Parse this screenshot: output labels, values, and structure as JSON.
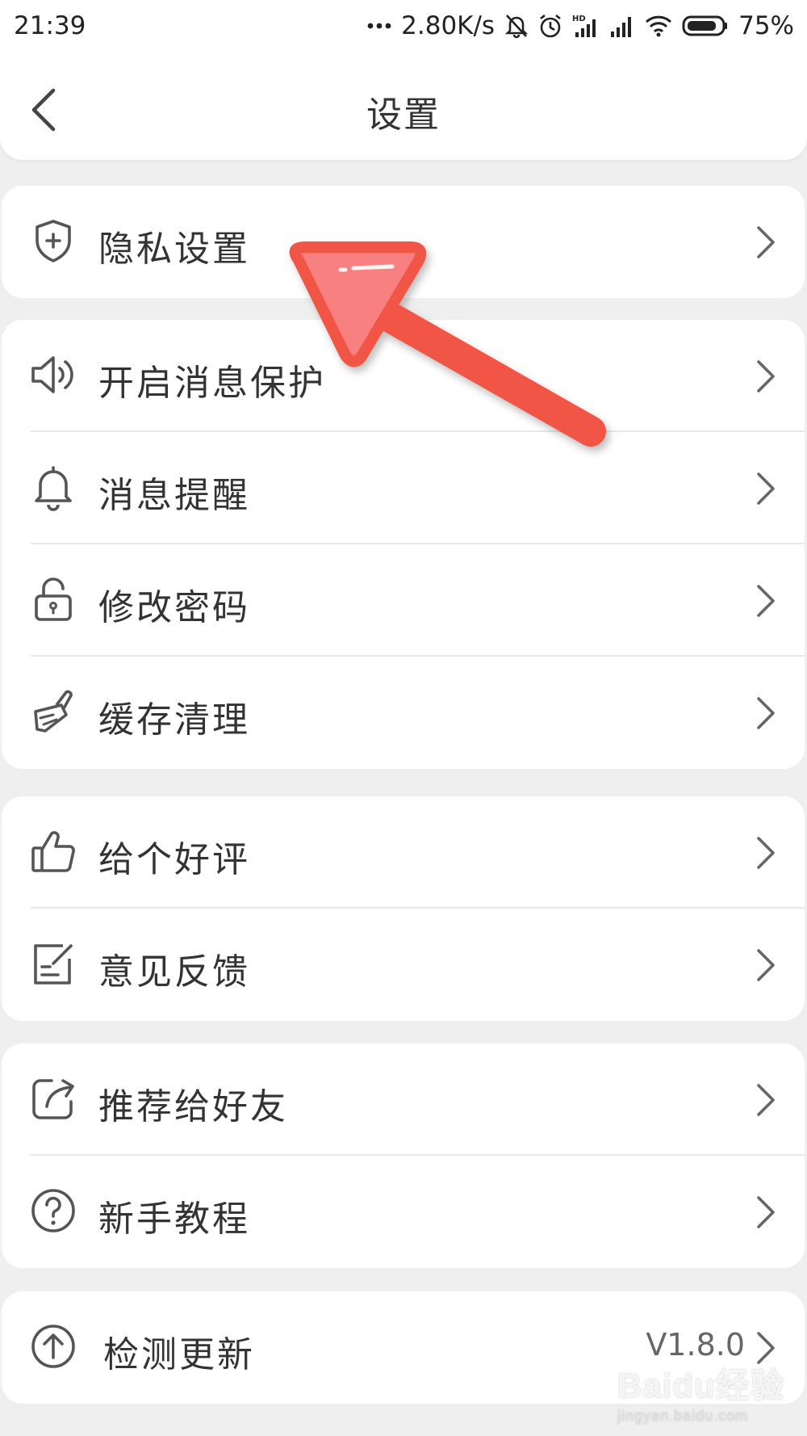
{
  "status_bar": {
    "time": "21:39",
    "network_speed": "2.80K/s",
    "battery_percent": "75%",
    "icons": [
      "more-dots-icon",
      "mute-icon",
      "alarm-icon",
      "hd-signal-icon",
      "signal-icon",
      "wifi-icon",
      "battery-icon"
    ]
  },
  "header": {
    "title": "设置",
    "back_icon": "chevron-left-icon"
  },
  "groups": [
    {
      "items": [
        {
          "label": "隐私设置",
          "icon": "shield-plus-icon"
        }
      ]
    },
    {
      "items": [
        {
          "label": "开启消息保护",
          "icon": "speaker-icon"
        },
        {
          "label": "消息提醒",
          "icon": "bell-icon"
        },
        {
          "label": "修改密码",
          "icon": "lock-icon"
        },
        {
          "label": "缓存清理",
          "icon": "broom-icon"
        }
      ]
    },
    {
      "items": [
        {
          "label": "给个好评",
          "icon": "thumbs-up-icon"
        },
        {
          "label": "意见反馈",
          "icon": "feedback-edit-icon"
        }
      ]
    },
    {
      "items": [
        {
          "label": "推荐给好友",
          "icon": "share-icon"
        },
        {
          "label": "新手教程",
          "icon": "help-circle-icon"
        }
      ]
    },
    {
      "items": [
        {
          "label": "检测更新",
          "icon": "upload-circle-icon",
          "value": "V1.8.0"
        }
      ]
    }
  ],
  "colors": {
    "annotation_arrow": "#f05545",
    "background": "#efefef",
    "card": "#ffffff",
    "text": "#333333",
    "icon": "#555555"
  },
  "watermark": {
    "brand": "Baidu经验",
    "url": "jingyan.baidu.com"
  }
}
